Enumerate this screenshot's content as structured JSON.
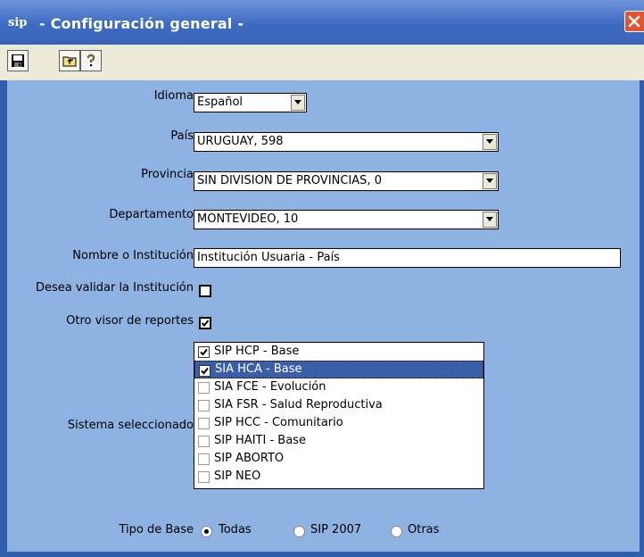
{
  "window": {
    "title": "- Configuración general -",
    "app_icon": "sip"
  },
  "toolbar": {
    "icons": [
      "save-icon",
      "folder-up-icon",
      "help-icon"
    ]
  },
  "form": {
    "idioma": {
      "label": "Idioma",
      "value": "Español"
    },
    "pais": {
      "label": "País",
      "value": "URUGUAY, 598"
    },
    "provincia": {
      "label": "Provincia",
      "value": "SIN DIVISION DE PROVINCIAS, 0"
    },
    "departamento": {
      "label": "Departamento",
      "value": "MONTEVIDEO, 10"
    },
    "institucion": {
      "label": "Nombre o Institución",
      "value": "Institución Usuaria - País"
    },
    "validar": {
      "label": "Desea validar la Institución",
      "checked": false
    },
    "visor": {
      "label": "Otro visor de reportes",
      "checked": true
    },
    "sistema": {
      "label": "Sistema seleccionado",
      "items": [
        {
          "label": "SIP HCP - Base",
          "checked": true,
          "selected": false
        },
        {
          "label": "SIA HCA - Base",
          "checked": true,
          "selected": true
        },
        {
          "label": "SIA FCE - Evolución",
          "checked": false,
          "selected": false
        },
        {
          "label": "SIA FSR - Salud Reproductiva",
          "checked": false,
          "selected": false
        },
        {
          "label": "SIP HCC - Comunitario",
          "checked": false,
          "selected": false
        },
        {
          "label": "SIP HAITI - Base",
          "checked": false,
          "selected": false
        },
        {
          "label": "SIP ABORTO",
          "checked": false,
          "selected": false
        },
        {
          "label": "SIP NEO",
          "checked": false,
          "selected": false
        }
      ]
    },
    "tipo_base": {
      "label": "Tipo de Base",
      "options": [
        "Todas",
        "SIP 2007",
        "Otras"
      ],
      "selected": "Todas"
    }
  },
  "colors": {
    "title_bar": "#3d6bc2",
    "content_bg": "#8eb2e1",
    "selection": "#3b5ea8",
    "close": "#e2542e"
  }
}
